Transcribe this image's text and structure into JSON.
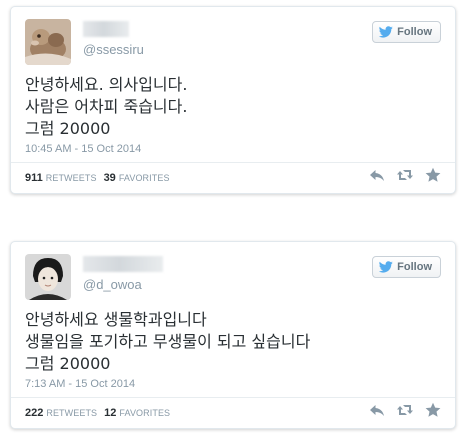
{
  "tweets": [
    {
      "handle": "@ssessiru",
      "follow_label": "Follow",
      "lines": [
        "안녕하세요. 의사입니다.",
        "사람은 어차피 죽습니다.",
        "그럼 20000"
      ],
      "timestamp": "10:45 AM - 15 Oct 2014",
      "retweets_count": "911",
      "retweets_label": "RETWEETS",
      "favorites_count": "39",
      "favorites_label": "FAVORITES"
    },
    {
      "handle": "@d_owoa",
      "follow_label": "Follow",
      "lines": [
        "안녕하세요 생물학과입니다",
        "생물임을 포기하고 무생물이 되고 싶습니다",
        "그럼 20000"
      ],
      "timestamp": "7:13 AM - 15 Oct 2014",
      "retweets_count": "222",
      "retweets_label": "RETWEETS",
      "favorites_count": "12",
      "favorites_label": "FAVORITES"
    }
  ],
  "icons": {
    "follow": "twitter-bird-icon",
    "reply": "reply-icon",
    "retweet": "retweet-icon",
    "favorite": "star-icon"
  },
  "colors": {
    "twitter_blue": "#55acee",
    "icon_gray": "#8899a6",
    "text": "#292f33"
  }
}
